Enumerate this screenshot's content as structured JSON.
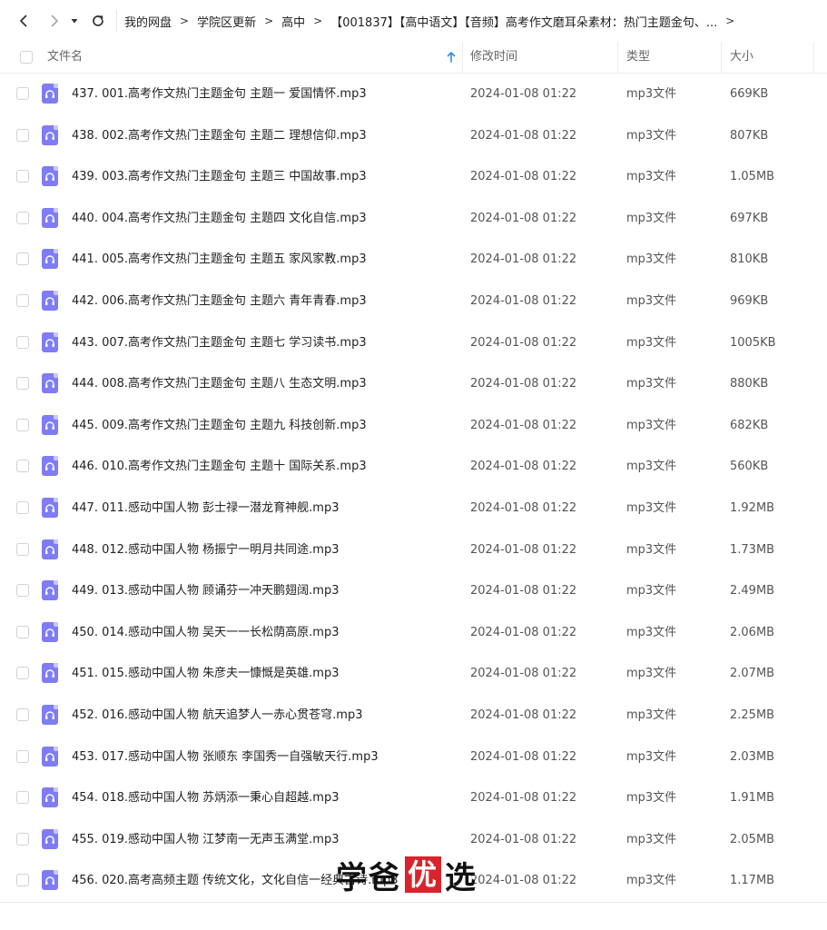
{
  "breadcrumb": [
    "我的网盘",
    "学院区更新",
    "高中",
    "【001837】【高中语文】【音频】高考作文磨耳朵素材：热门主题金句、..."
  ],
  "breadcrumb_separator": ">",
  "columns": {
    "name": "文件名",
    "modified": "修改时间",
    "type": "类型",
    "size": "大小"
  },
  "files": [
    {
      "name": "437. 001.高考作文热门主题金句  主题一 爱国情怀.mp3",
      "modified": "2024-01-08 01:22",
      "type": "mp3文件",
      "size": "669KB"
    },
    {
      "name": "438. 002.高考作文热门主题金句  主题二 理想信仰.mp3",
      "modified": "2024-01-08 01:22",
      "type": "mp3文件",
      "size": "807KB"
    },
    {
      "name": "439. 003.高考作文热门主题金句  主题三 中国故事.mp3",
      "modified": "2024-01-08 01:22",
      "type": "mp3文件",
      "size": "1.05MB"
    },
    {
      "name": "440. 004.高考作文热门主题金句  主题四 文化自信.mp3",
      "modified": "2024-01-08 01:22",
      "type": "mp3文件",
      "size": "697KB"
    },
    {
      "name": "441. 005.高考作文热门主题金句  主题五 家风家教.mp3",
      "modified": "2024-01-08 01:22",
      "type": "mp3文件",
      "size": "810KB"
    },
    {
      "name": "442. 006.高考作文热门主题金句  主题六 青年青春.mp3",
      "modified": "2024-01-08 01:22",
      "type": "mp3文件",
      "size": "969KB"
    },
    {
      "name": "443. 007.高考作文热门主题金句  主题七 学习读书.mp3",
      "modified": "2024-01-08 01:22",
      "type": "mp3文件",
      "size": "1005KB"
    },
    {
      "name": "444. 008.高考作文热门主题金句  主题八 生态文明.mp3",
      "modified": "2024-01-08 01:22",
      "type": "mp3文件",
      "size": "880KB"
    },
    {
      "name": "445. 009.高考作文热门主题金句  主题九 科技创新.mp3",
      "modified": "2024-01-08 01:22",
      "type": "mp3文件",
      "size": "682KB"
    },
    {
      "name": "446. 010.高考作文热门主题金句  主题十 国际关系.mp3",
      "modified": "2024-01-08 01:22",
      "type": "mp3文件",
      "size": "560KB"
    },
    {
      "name": "447. 011.感动中国人物  彭士禄一潜龙育神舰.mp3",
      "modified": "2024-01-08 01:22",
      "type": "mp3文件",
      "size": "1.92MB"
    },
    {
      "name": "448. 012.感动中国人物  杨振宁一明月共同途.mp3",
      "modified": "2024-01-08 01:22",
      "type": "mp3文件",
      "size": "1.73MB"
    },
    {
      "name": "449. 013.感动中国人物  顾诵芬一冲天鹏翅阔.mp3",
      "modified": "2024-01-08 01:22",
      "type": "mp3文件",
      "size": "2.49MB"
    },
    {
      "name": "450. 014.感动中国人物  吴天一一长松荫高原.mp3",
      "modified": "2024-01-08 01:22",
      "type": "mp3文件",
      "size": "2.06MB"
    },
    {
      "name": "451. 015.感动中国人物  朱彦夫一慷慨是英雄.mp3",
      "modified": "2024-01-08 01:22",
      "type": "mp3文件",
      "size": "2.07MB"
    },
    {
      "name": "452. 016.感动中国人物  航天追梦人一赤心贯苍穹.mp3",
      "modified": "2024-01-08 01:22",
      "type": "mp3文件",
      "size": "2.25MB"
    },
    {
      "name": "453. 017.感动中国人物  张顺东 李国秀一自强敏天行.mp3",
      "modified": "2024-01-08 01:22",
      "type": "mp3文件",
      "size": "2.03MB"
    },
    {
      "name": "454. 018.感动中国人物  苏炳添一秉心自超越.mp3",
      "modified": "2024-01-08 01:22",
      "type": "mp3文件",
      "size": "1.91MB"
    },
    {
      "name": "455. 019.感动中国人物  江梦南一无声玉满堂.mp3",
      "modified": "2024-01-08 01:22",
      "type": "mp3文件",
      "size": "2.05MB"
    },
    {
      "name": "456. 020.高考高频主题  传统文化，文化自信一经典古诗.mp3",
      "modified": "2024-01-08 01:22",
      "type": "mp3文件",
      "size": "1.17MB"
    }
  ],
  "watermark": {
    "left": "学爸",
    "highlight": "优",
    "right": "选"
  },
  "icons": {
    "back": "back-arrow-icon",
    "forward": "forward-arrow-icon",
    "dropdown": "dropdown-caret-icon",
    "refresh": "refresh-icon",
    "sort": "sort-asc-arrow-icon",
    "file": "audio-file-icon"
  },
  "colors": {
    "accent": "#2d8cf0",
    "file_icon": "#7e7cf6",
    "watermark_red": "#d8242c"
  }
}
